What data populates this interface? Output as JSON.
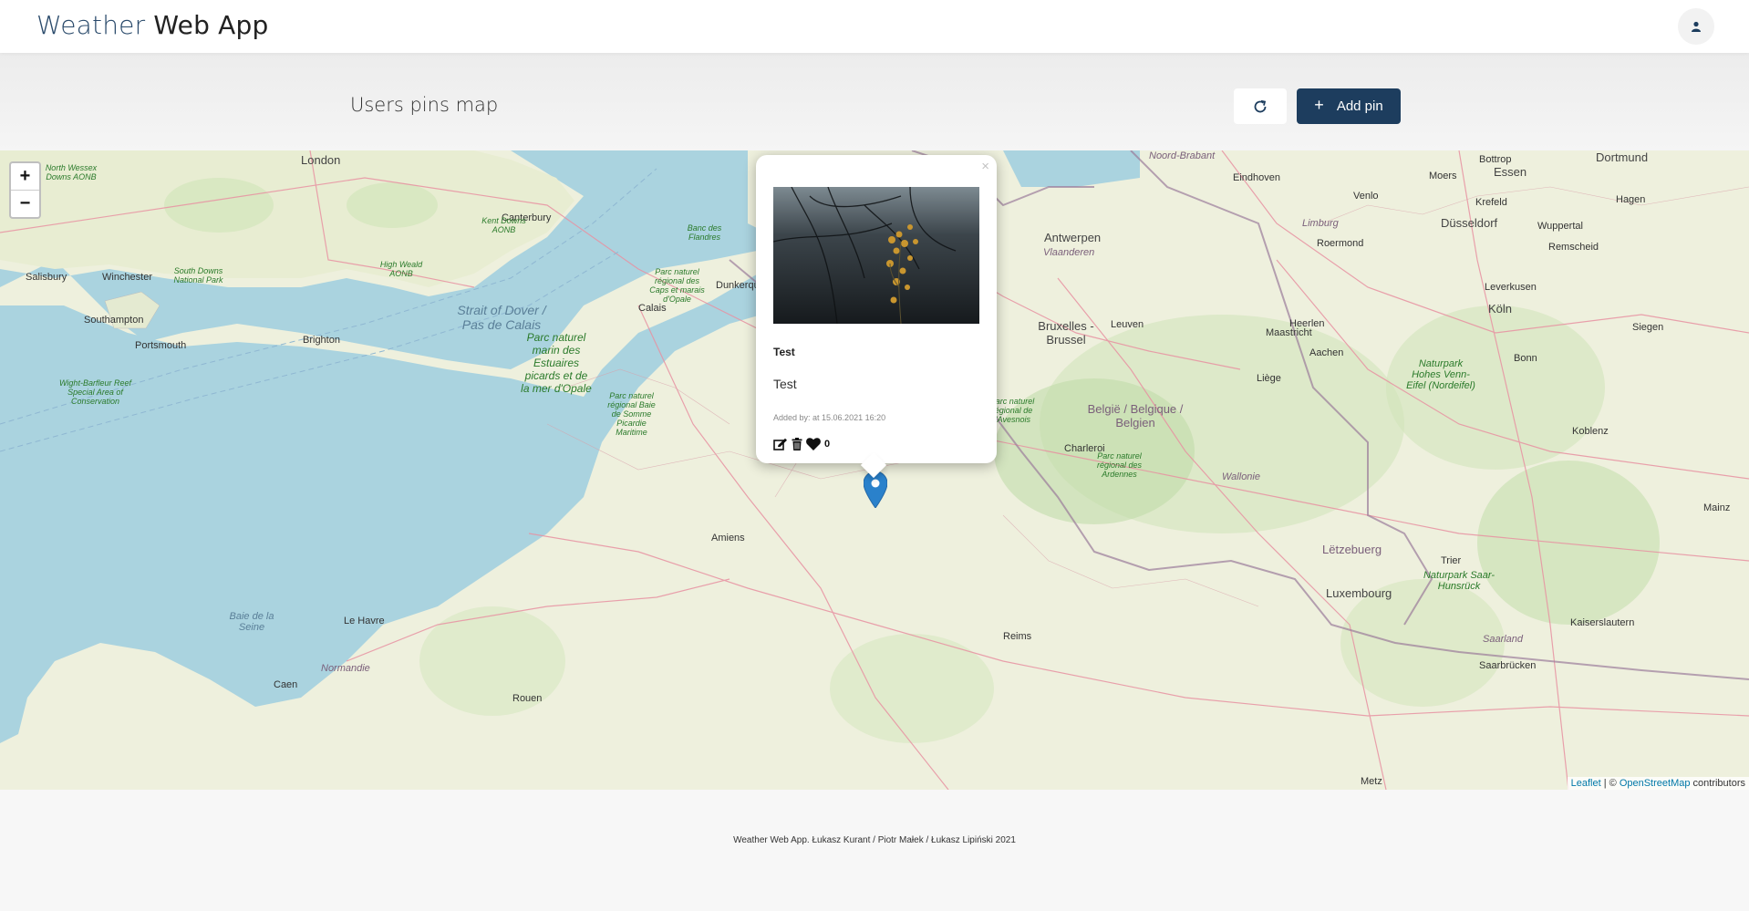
{
  "app": {
    "brand_first": "Weather",
    "brand_rest": " Web App"
  },
  "header": {
    "user_icon": "user-icon"
  },
  "toolbar": {
    "page_title": "Users pins map",
    "refresh_icon": "refresh-icon",
    "add_pin_label": "Add pin",
    "add_pin_icon": "plus-icon"
  },
  "map": {
    "zoom_in": "+",
    "zoom_out": "−",
    "attribution_leaflet": "Leaflet",
    "attribution_sep": " | © ",
    "attribution_osm": "OpenStreetMap",
    "attribution_tail": " contributors",
    "labels": {
      "london": "London",
      "canterbury": "Canterbury",
      "salisbury": "Salisbury",
      "winchester": "Winchester",
      "southampton": "Southampton",
      "portsmouth": "Portsmouth",
      "brighton": "Brighton",
      "calais": "Calais",
      "dunkerque": "Dunkerque",
      "amiens": "Amiens",
      "le_havre": "Le Havre",
      "rouen": "Rouen",
      "caen": "Caen",
      "normandie": "Normandie",
      "reims": "Reims",
      "metz": "Metz",
      "antwerpen": "Antwerpen",
      "bruxelles": "Bruxelles - Brussel",
      "leuven": "Leuven",
      "liege": "Liège",
      "maastricht": "Maastricht",
      "charleroi": "Charleroi",
      "belgique": "België / Belgique / Belgien",
      "wallonie": "Wallonie",
      "eindhoven": "Eindhoven",
      "venlo": "Venlo",
      "roermond": "Roermond",
      "limburg": "Limburg",
      "essen": "Essen",
      "dortmund": "Dortmund",
      "dusseldorf": "Düsseldorf",
      "koln": "Köln",
      "bonn": "Bonn",
      "aachen": "Aachen",
      "heerlen": "Heerlen",
      "letzebuerg": "Lëtzebuerg",
      "luxembourg": "Luxembourg",
      "trier": "Trier",
      "koblenz": "Koblenz",
      "mainz": "Mainz",
      "siegen": "Siegen",
      "kaiserslautern": "Kaiserslautern",
      "saarbrucken": "Saarbrücken",
      "saarland": "Saarland",
      "vlaanderen": "Vlaanderen",
      "strait": "Strait of Dover / Pas de Calais",
      "baie_seine": "Baie de la Seine",
      "krefeld": "Krefeld",
      "moers": "Moers",
      "hagen": "Hagen",
      "wuppertal": "Wuppertal",
      "remscheid": "Remscheid",
      "leverkusen": "Leverkusen",
      "bottrop": "Bottrop",
      "noord_brabant": "Noord-Brabant",
      "pn_marin": "Parc naturel marin des Estuaires picards et de la mer d'Opale",
      "pn_caps": "Parc naturel régional des Caps et marais d'Opale",
      "pn_somme": "Parc naturel régional Baie de Somme Picardie Maritime",
      "pn_avesnois": "Parc naturel régional de l'Avesnois",
      "pn_ardennes": "Parc naturel régional des Ardennes",
      "north_wessex": "North Wessex Downs AONB",
      "kent_downs": "Kent Downs AONB",
      "south_downs": "South Downs National Park",
      "high_weald": "High Weald AONB",
      "banc": "Banc des Flandres",
      "wight": "Wight-Barfleur Reef Special Area of Conservation",
      "saar_hunsruck": "Naturpark Saar-Hunsrück",
      "hohes_venn": "Naturpark Hohes Venn-Eifel (Nordeifel)"
    }
  },
  "popup": {
    "close": "×",
    "title": "Test",
    "description": "Test",
    "meta": "Added by: at 15.06.2021 16:20",
    "likes": "0",
    "edit_icon": "edit-icon",
    "delete_icon": "trash-icon",
    "like_icon": "heart-icon"
  },
  "footer": {
    "text": "Weather Web App. Łukasz Kurant / Piotr Małek / Łukasz Lipiński 2021"
  }
}
